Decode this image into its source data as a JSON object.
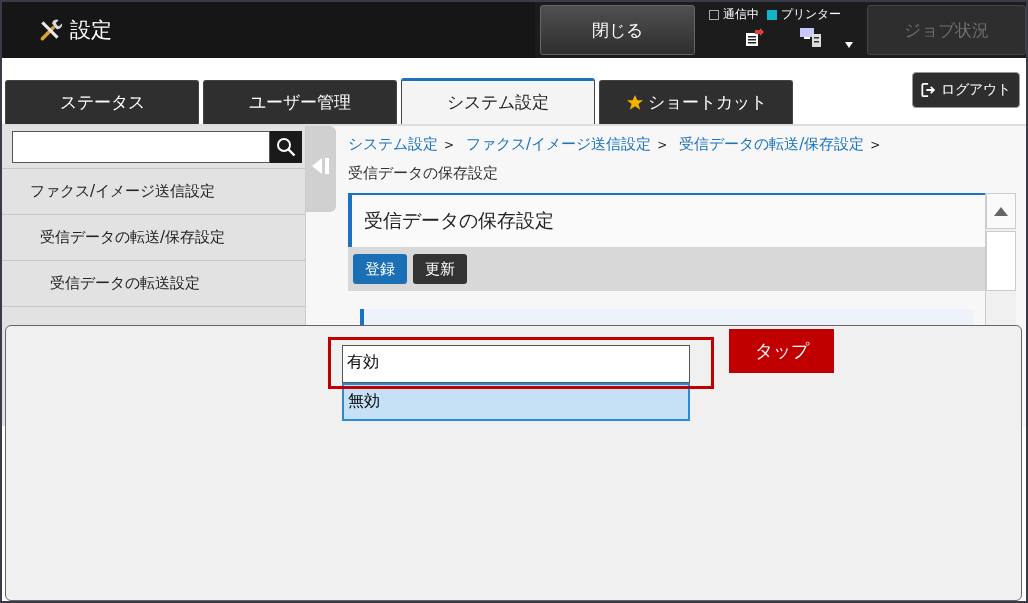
{
  "header": {
    "title": "設定",
    "close_button": "閉じる",
    "indicators": [
      {
        "label": "通信中",
        "checked": false
      },
      {
        "label": "プリンター",
        "checked": true
      }
    ],
    "job_status_button": {
      "label": "ジョブ状況",
      "disabled": true
    }
  },
  "tabs": [
    {
      "label": "ステータス",
      "selected": false,
      "starred": false
    },
    {
      "label": "ユーザー管理",
      "selected": false,
      "starred": false
    },
    {
      "label": "システム設定",
      "selected": true,
      "starred": false
    },
    {
      "label": "ショートカット",
      "selected": false,
      "starred": true
    }
  ],
  "logout_button": "ログアウト",
  "sidebar": {
    "items": [
      {
        "label": "ファクス/イメージ送信設定",
        "children": [
          {
            "label": "受信データの転送/保存設定",
            "children": [
              {
                "label": "受信データの転送設定"
              }
            ]
          }
        ]
      }
    ]
  },
  "breadcrumb": {
    "links": [
      "システム設定",
      "ファクス/イメージ送信設定",
      "受信データの転送/保存設定"
    ],
    "separator": ">",
    "current": "受信データの保存設定"
  },
  "page_title": "受信データの保存設定",
  "toolbar": [
    {
      "label": "登録",
      "kind": "primary"
    },
    {
      "label": "更新",
      "kind": "secondary"
    }
  ],
  "dropdown": {
    "options": [
      {
        "label": "有効",
        "selected": false
      },
      {
        "label": "無効",
        "selected": true
      }
    ]
  },
  "callout": "タップ"
}
